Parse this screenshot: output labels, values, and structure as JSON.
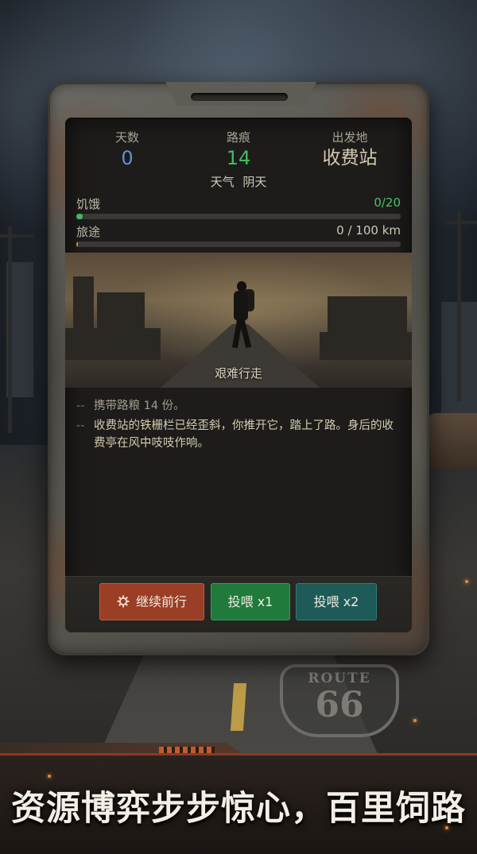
{
  "stats": {
    "days_label": "天数",
    "days_value": "0",
    "trail_label": "路痕",
    "trail_value": "14",
    "origin_label": "出发地",
    "origin_value": "收费站"
  },
  "weather": {
    "label": "天气",
    "value": "阴天"
  },
  "bars": {
    "hunger": {
      "name": "饥饿",
      "value": "0/20",
      "fill_fraction": 0.02
    },
    "journey": {
      "name": "旅途",
      "value": "0 / 100 km",
      "fill_fraction": 0.005
    }
  },
  "scene": {
    "caption": "艰难行走"
  },
  "log": [
    {
      "dash": "--",
      "text": "携带路粮 14 份。"
    },
    {
      "dash": "--",
      "text": "收费站的铁栅栏已经歪斜，你推开它，踏上了路。身后的收费亭在风中吱吱作响。"
    }
  ],
  "actions": {
    "continue_label": "继续前行",
    "continue_icon": "gear-icon",
    "feed1_label": "投喂 x1",
    "feed2_label": "投喂 x2"
  },
  "route_sign": {
    "word": "ROUTE",
    "number": "66"
  },
  "banner": {
    "slogan": "资源博弈步步惊心，百里饲路"
  },
  "colors": {
    "days": "#5a94d6",
    "trail": "#3fbf5e",
    "continue_button": "#9a3e26",
    "feed1_button": "#1f7a3c",
    "feed2_button": "#1e5a57"
  }
}
